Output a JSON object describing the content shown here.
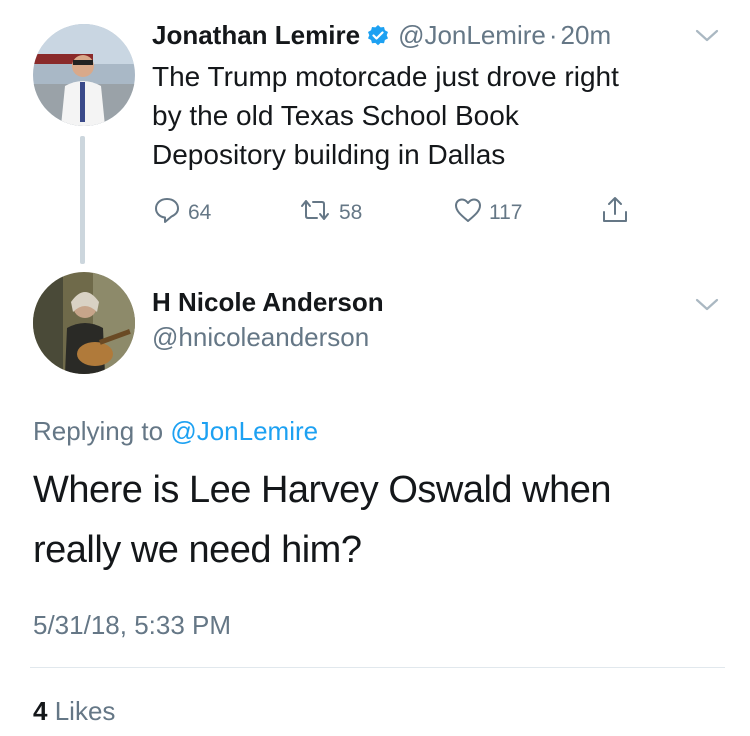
{
  "parent_tweet": {
    "author_name": "Jonathan Lemire",
    "handle": "@JonLemire",
    "separator": "·",
    "time": "20m",
    "text_lines": [
      "The Trump motorcade just drove right",
      "by the old Texas School Book",
      "Depository building in Dallas"
    ],
    "replies": "64",
    "retweets": "58",
    "likes": "117"
  },
  "reply_tweet": {
    "author_name": "H Nicole Anderson",
    "handle": "@hnicoleanderson",
    "replying_prefix": "Replying to",
    "replying_to": "@JonLemire",
    "text_lines": [
      "Where is Lee Harvey Oswald when",
      "really we need him?"
    ],
    "timestamp": "5/31/18, 5:33 PM",
    "likes_count": "4",
    "likes_label": "Likes"
  },
  "colors": {
    "link": "#1da1f2",
    "muted": "#657786",
    "verified": "#1da1f2"
  },
  "icons": [
    "reply-icon",
    "retweet-icon",
    "like-icon",
    "share-icon",
    "verified-badge-icon",
    "chevron-down-icon"
  ]
}
